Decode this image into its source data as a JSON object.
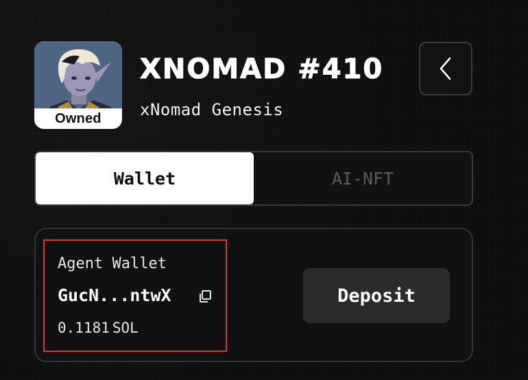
{
  "header": {
    "badge": "Owned",
    "title": "XNOMAD #410",
    "collection": "xNomad Genesis",
    "back_icon": "chevron-left-icon"
  },
  "tabs": [
    {
      "label": "Wallet",
      "active": true
    },
    {
      "label": "AI-NFT",
      "active": false
    }
  ],
  "wallet": {
    "label": "Agent Wallet",
    "address": "GucN...ntwX",
    "copy_icon": "copy-icon",
    "balance": "0.1181",
    "unit": "SOL",
    "deposit_label": "Deposit"
  },
  "colors": {
    "background": "#0e0e0f",
    "highlight": "#e0362a",
    "deposit_bg": "#2b2b2d",
    "inactive_tab": "#5c5c60"
  }
}
